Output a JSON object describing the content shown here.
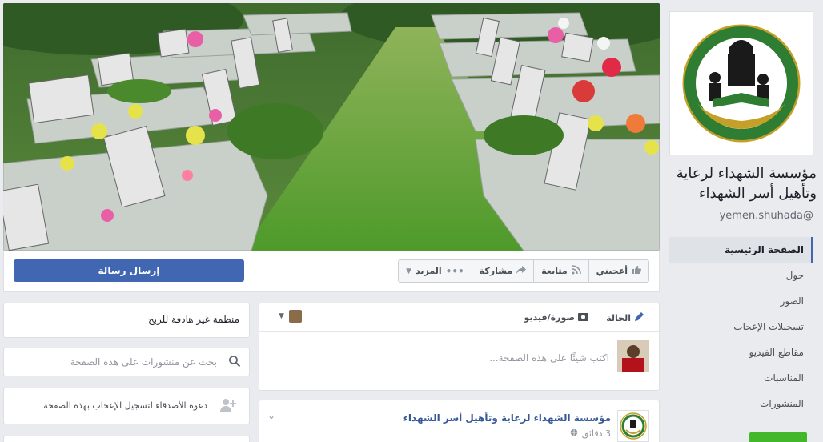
{
  "page": {
    "name": "مؤسسة الشهداء لرعاية وتأهيل أسر الشهداء",
    "username": "yemen.shuhada@"
  },
  "cover": {
    "alt": ""
  },
  "actions": {
    "send_message": "إرسال رسالة",
    "like": "أعجبني",
    "follow": "متابعة",
    "share": "مشاركة",
    "more": "المزيد"
  },
  "nav": {
    "items": [
      {
        "label": "الصفحة الرئيسية",
        "active": true
      },
      {
        "label": "حول"
      },
      {
        "label": "الصور"
      },
      {
        "label": "تسجيلات الإعجاب"
      },
      {
        "label": "مقاطع الفيديو"
      },
      {
        "label": "المناسبات"
      },
      {
        "label": "المنشورات"
      }
    ]
  },
  "about": {
    "category": "منظمة غير هادفة للربح"
  },
  "search": {
    "placeholder": "بحث عن منشورات على هذه الصفحة"
  },
  "invite": {
    "text": "دعوة الأصدقاء لتسجيل الإعجاب بهذه الصفحة"
  },
  "composer": {
    "tab_status": "الحالة",
    "tab_photo_video": "صورة/فيديو",
    "placeholder": "اكتب شيئًا على هذه الصفحة..."
  },
  "post": {
    "author": "مؤسسة الشهداء لرعاية وتأهيل أسر الشهداء",
    "time": "3 دقائق"
  },
  "colors": {
    "brand_blue": "#4267b2",
    "link_blue": "#365899",
    "background": "#e9ebee",
    "green_button": "#42b72a",
    "logo_green": "#2e7d32",
    "logo_gold": "#c5a028"
  },
  "icons": [
    "thumbs-up-icon",
    "rss-icon",
    "share-arrow-icon",
    "more-dots-icon",
    "chevron-down-icon",
    "search-icon",
    "add-friend-icon",
    "pencil-icon",
    "camera-icon",
    "globe-icon"
  ]
}
